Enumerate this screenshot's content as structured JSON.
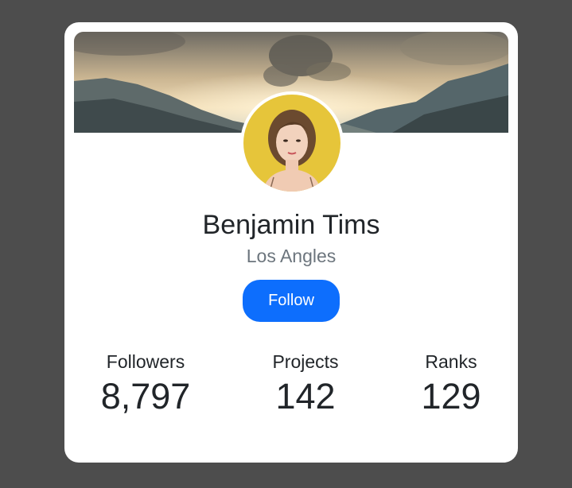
{
  "profile": {
    "name": "Benjamin Tims",
    "location": "Los Angles",
    "follow_label": "Follow"
  },
  "stats": [
    {
      "label": "Followers",
      "value": "8,797"
    },
    {
      "label": "Projects",
      "value": "142"
    },
    {
      "label": "Ranks",
      "value": "129"
    }
  ],
  "colors": {
    "page_background": "#4d4d4d",
    "card_background": "#ffffff",
    "button": "#0d6efd",
    "name_text": "#212529",
    "location_text": "#6c757d"
  }
}
